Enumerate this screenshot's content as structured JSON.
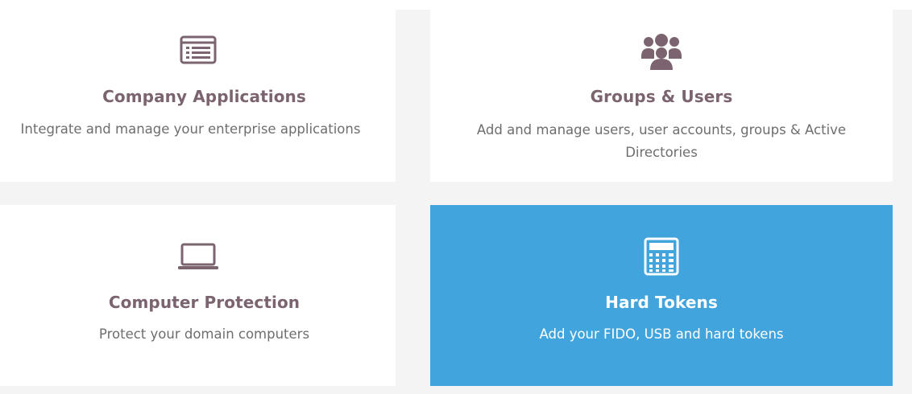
{
  "colors": {
    "muted_purple": "#7b6470",
    "active_blue": "#42a4dc",
    "background_gray": "#f4f4f4"
  },
  "cards": [
    {
      "title": "Company Applications",
      "description": "Integrate and manage your enterprise applications",
      "icon": "list-window-icon"
    },
    {
      "title": "Groups & Users",
      "description": "Add and manage users, user accounts, groups & Active Directories",
      "icon": "users-group-icon"
    },
    {
      "title": "Computer Protection",
      "description": "Protect your domain computers",
      "icon": "laptop-icon"
    },
    {
      "title": "Hard Tokens",
      "description": "Add your FIDO, USB and hard tokens",
      "icon": "calculator-icon",
      "active": true
    }
  ]
}
